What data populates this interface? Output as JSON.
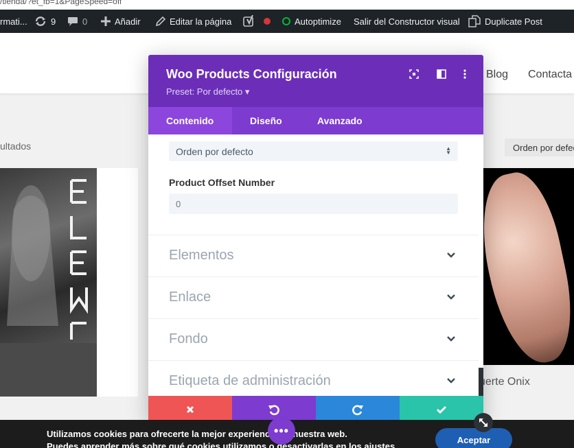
{
  "url_fragment": "/tienda/?et_fb=1&PageSpeed=off",
  "adminbar": {
    "item_left": "rmati...",
    "updates_count": "9",
    "comments_count": "0",
    "add_label": "Añadir",
    "edit_label": "Editar la página",
    "autoptimize_label": "Autoptimize",
    "exit_builder_label": "Salir del Constructor visual",
    "duplicate_label": "Duplicate Post"
  },
  "site": {
    "nav_blog": "Blog",
    "nav_contact": "Contacta",
    "results_text": "ultados",
    "sort_label": "Orden por defecto",
    "product_title": "suerte Onix"
  },
  "modal": {
    "title": "Woo Products Configuración",
    "preset": "Preset: Por defecto ▾",
    "tabs": [
      "Contenido",
      "Diseño",
      "Avanzado"
    ],
    "order_select_value": "Orden por defecto",
    "offset_label": "Product Offset Number",
    "offset_placeholder": "0",
    "toggles": [
      "Elementos",
      "Enlace",
      "Fondo",
      "Etiqueta de administración"
    ]
  },
  "footer_buttons": {
    "cancel_color": "#ef5555",
    "undo_color": "#7d3bd0",
    "redo_color": "#2b87da",
    "save_color": "#29c4a9"
  },
  "cookie": {
    "line1": "Utilizamos cookies para ofrecerte la mejor experiencia en nuestra web.",
    "line2": "Puedes aprender más sobre qué cookies utilizamos o desactivarlas en los ajustes.",
    "accept_label": "Aceptar"
  },
  "colors": {
    "header_purple": "#6c2eb9",
    "tabs_purple": "#7d3bd0",
    "adminbar": "#1d2327"
  }
}
